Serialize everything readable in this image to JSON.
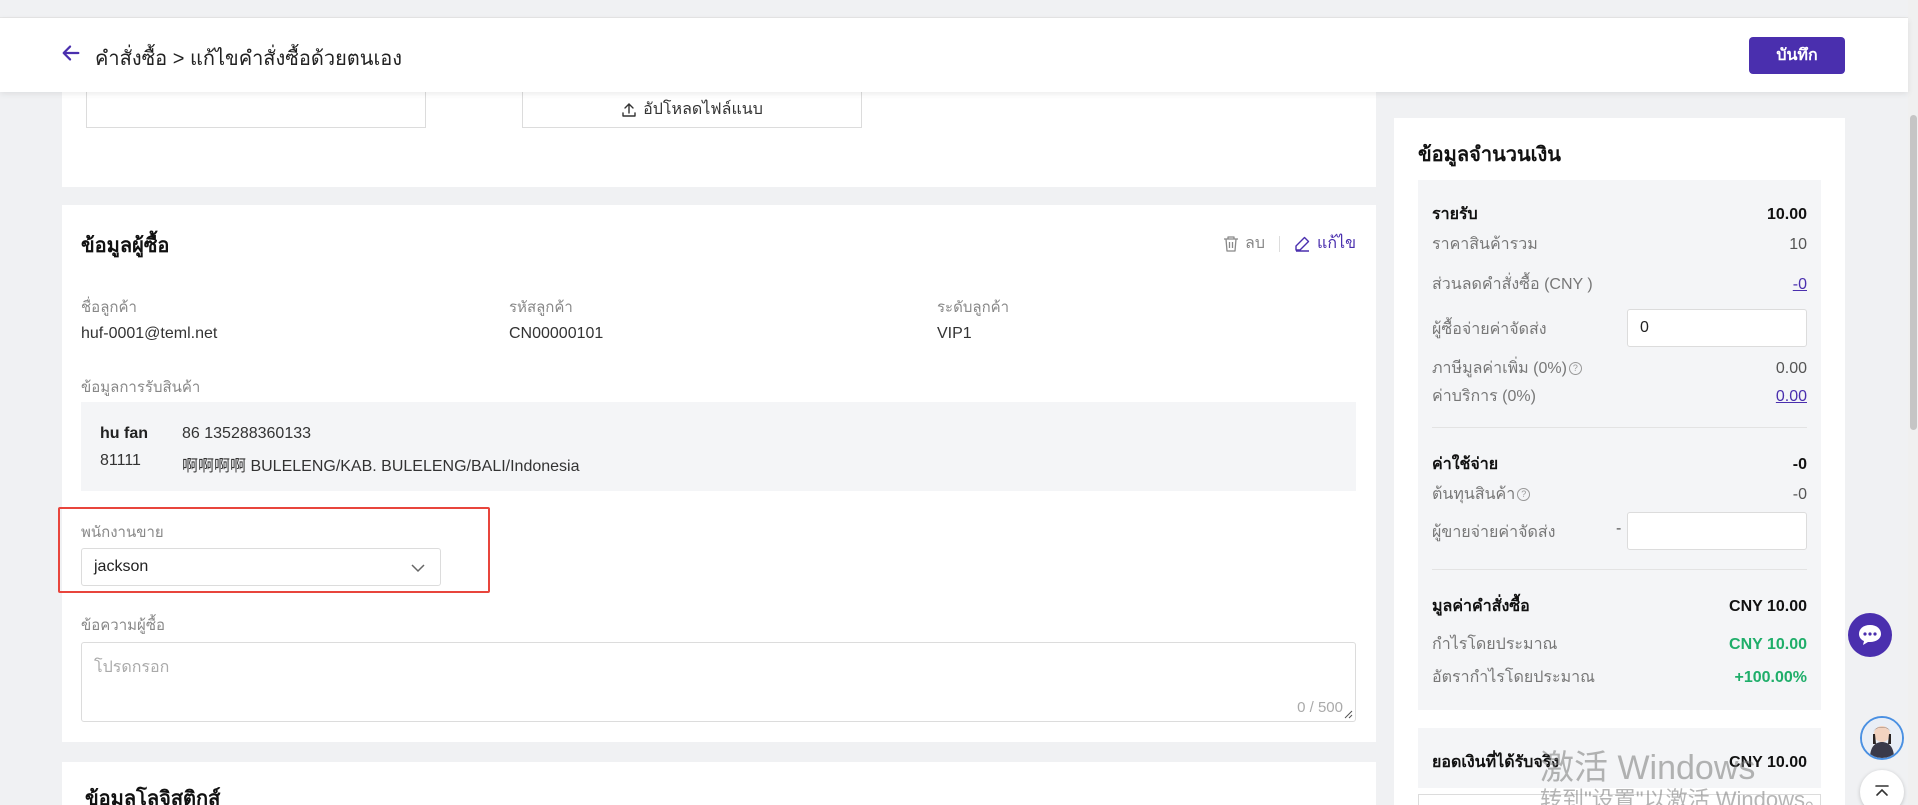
{
  "header": {
    "breadcrumb": "คำสั่งซื้อ > แก้ไขคำสั่งซื้อด้วยตนเอง",
    "save_label": "บันทึก"
  },
  "upload": {
    "button_label": "อัปโหลดไฟล์แนบ"
  },
  "buyer": {
    "title": "ข้อมูลผู้ซื้อ",
    "delete_label": "ลบ",
    "edit_label": "แก้ไข",
    "customer_name_label": "ชื่อลูกค้า",
    "customer_name": "huf-0001@teml.net",
    "customer_code_label": "รหัสลูกค้า",
    "customer_code": "CN00000101",
    "customer_level_label": "ระดับลูกค้า",
    "customer_level": "VIP1",
    "receive_label": "ข้อมูลการรับสินค้า",
    "recipient_name": "hu fan",
    "recipient_phone": "86 135288360133",
    "postal_code": "81111",
    "address": "啊啊啊啊 BULELENG/KAB. BULELENG/BALI/Indonesia",
    "salesperson_label": "พนักงานขาย",
    "salesperson_value": "jackson",
    "message_label": "ข้อความผู้ซื้อ",
    "message_placeholder": "โปรดกรอก",
    "message_count": "0 / 500"
  },
  "logistics": {
    "title": "ข้อมูลโลจิสติกส์"
  },
  "money": {
    "title": "ข้อมูลจำนวนเงิน",
    "income_label": "รายรับ",
    "income_value": "10.00",
    "goods_total_label": "ราคาสินค้ารวม",
    "goods_total_value": "10",
    "discount_label": "ส่วนลดคำสั่งซื้อ (CNY )",
    "discount_value": "-0",
    "buyer_shipping_label": "ผู้ซื้อจ่ายค่าจัดส่ง",
    "buyer_shipping_value": "0",
    "vat_label": "ภาษีมูลค่าเพิ่ม (0%)",
    "vat_value": "0.00",
    "service_label": "ค่าบริการ (0%)",
    "service_value": "0.00",
    "expense_label": "ค่าใช้จ่าย",
    "expense_value": "-0",
    "cost_label": "ต้นทุนสินค้า",
    "cost_value": "-0",
    "seller_shipping_label": "ผู้ขายจ่ายค่าจัดส่ง",
    "seller_shipping_prefix": "-",
    "order_value_label": "มูลค่าคำสั่งซื้อ",
    "order_value": "CNY 10.00",
    "est_profit_label": "กำไรโดยประมาณ",
    "est_profit_value": "CNY 10.00",
    "est_margin_label": "อัตรากำไรโดยประมาณ",
    "est_margin_value": "+100.00%",
    "actual_received_label": "ยอดเงินที่ได้รับจริง",
    "actual_received_value": "CNY 10.00"
  },
  "watermark": {
    "line1": "激活 Windows",
    "line2": "转到\"设置\"以激活 Windows。"
  },
  "colors": {
    "brand": "#4a2fae",
    "highlight": "#e8453c",
    "profit": "#1fae6a"
  }
}
